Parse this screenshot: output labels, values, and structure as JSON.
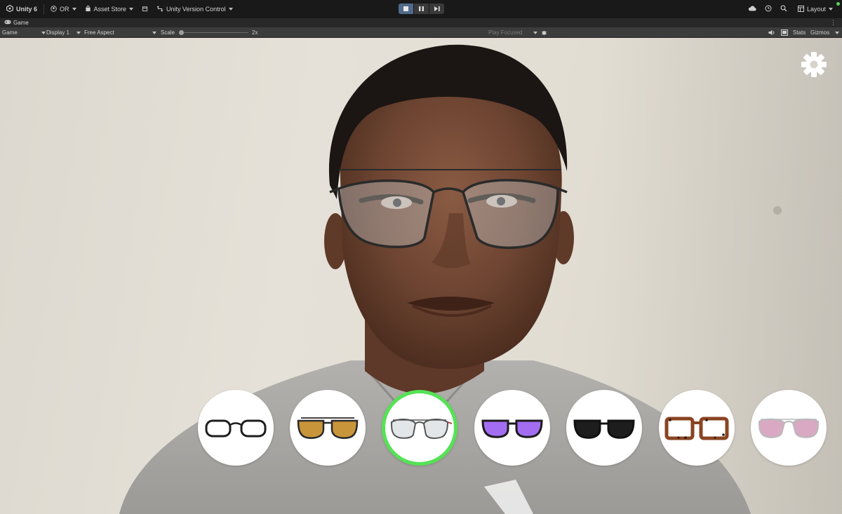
{
  "toolbar": {
    "app_name": "Unity 6",
    "account": "OR",
    "asset_store": "Asset Store",
    "version_control": "Unity Version Control",
    "layout": "Layout"
  },
  "tab": {
    "label": "Game"
  },
  "gamebar": {
    "display_mode": "Game",
    "display": "Display 1",
    "aspect": "Free Aspect",
    "scale_label": "Scale",
    "scale_value": "2x",
    "play_mode": "Play Focused",
    "stats": "Stats",
    "gizmos": "Gizmos"
  },
  "icons": {
    "settings": "gear-icon",
    "unity_logo": "unity-logo-icon",
    "stop": "stop-icon",
    "pause": "pause-icon",
    "step": "step-icon",
    "cloud": "cloud-icon",
    "history": "history-icon",
    "search": "search-icon",
    "bug": "bug-icon",
    "audio": "audio-icon"
  },
  "carousel": {
    "selected_index": 2,
    "frames": [
      {
        "name": "black-round-frame",
        "lens": "#ffffff",
        "frame": "#1d1d1d"
      },
      {
        "name": "gold-aviator-amber",
        "lens": "#c9953a",
        "frame": "#2a2a2a"
      },
      {
        "name": "silver-aviator-clear",
        "lens": "#e2e6e8",
        "frame": "#8a8a8a"
      },
      {
        "name": "purple-lens-sunglasses",
        "lens": "#a36df2",
        "frame": "#1b1b1b"
      },
      {
        "name": "black-sunglasses",
        "lens": "#1d1d1d",
        "frame": "#111111"
      },
      {
        "name": "tortoise-square-frame",
        "lens": "#ffffff",
        "frame": "#8a4422"
      },
      {
        "name": "pink-gradient-aviator",
        "lens": "#d9a9c4",
        "frame": "#b9b9b9"
      }
    ]
  },
  "colors": {
    "selection_ring": "#55e255",
    "editor_bg": "#191919",
    "gamebar_bg": "#3c3c3c"
  }
}
